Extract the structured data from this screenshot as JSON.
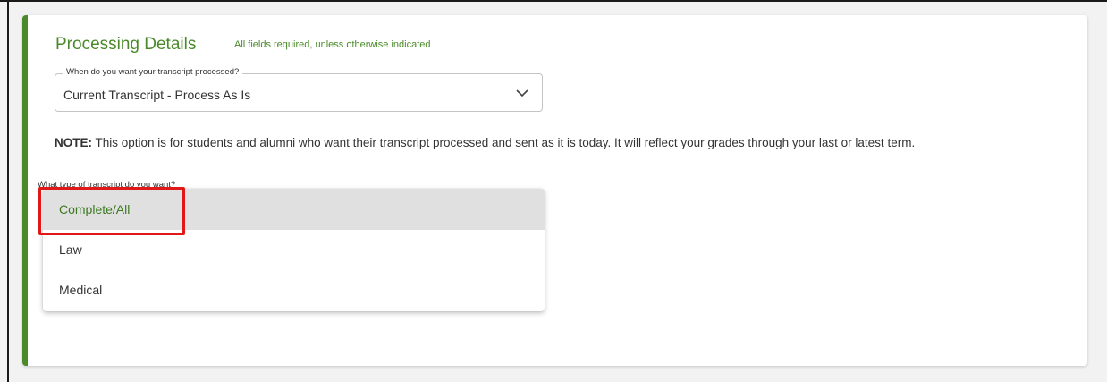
{
  "section": {
    "title": "Processing Details",
    "subtitle": "All fields required, unless otherwise indicated"
  },
  "processing_select": {
    "legend": "When do you want your transcript processed?",
    "value": "Current Transcript - Process As Is",
    "icon": "chevron-down-icon"
  },
  "note": {
    "label": "NOTE:",
    "text": " This option is for students and alumni who want their transcript processed and sent as it is today. It will reflect your grades through your last or latest term."
  },
  "type_select": {
    "legend": "What type of transcript do you want?",
    "options": [
      "Complete/All",
      "Law",
      "Medical"
    ],
    "selected_index": 0
  },
  "colors": {
    "accent_green": "#4a8a2a",
    "highlight_red": "#e01818"
  }
}
